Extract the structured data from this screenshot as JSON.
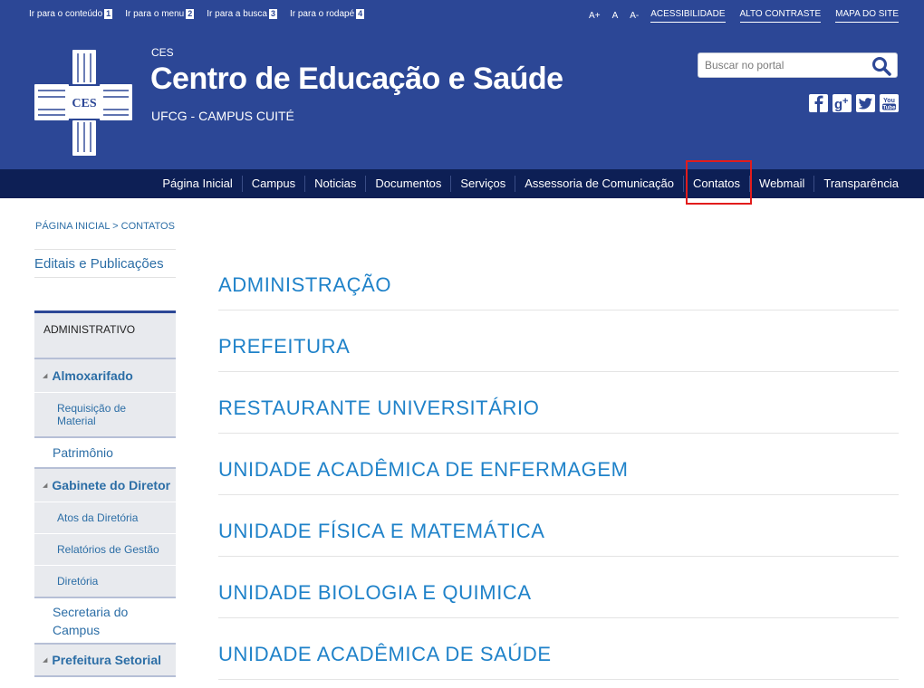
{
  "accessibility_bar": {
    "skip_links": [
      {
        "label": "Ir para o conteúdo",
        "key": "1"
      },
      {
        "label": "Ir para o menu",
        "key": "2"
      },
      {
        "label": "Ir para a busca",
        "key": "3"
      },
      {
        "label": "Ir para o rodapé",
        "key": "4"
      }
    ],
    "font_size_controls": [
      "A+",
      "A",
      "A-"
    ],
    "links": [
      "ACESSIBILIDADE",
      "ALTO CONTRASTE",
      "MAPA DO SITE"
    ]
  },
  "header": {
    "logo_text": "CES",
    "org_acronym": "CES",
    "title": "Centro de Educação e Saúde",
    "subtitle": "UFCG - CAMPUS CUITÉ",
    "search_placeholder": "Buscar no portal",
    "social_icons": [
      "facebook-icon",
      "google-plus-icon",
      "twitter-icon",
      "youtube-icon"
    ]
  },
  "nav": {
    "items": [
      "Página Inicial",
      "Campus",
      "Noticias",
      "Documentos",
      "Serviços",
      "Assessoria de Comunicação",
      "Contatos",
      "Webmail",
      "Transparência"
    ],
    "highlighted": "Contatos"
  },
  "breadcrumb": "PÁGINA INICIAL > CONTATOS",
  "sidebar": {
    "top_link": "Editais e Publicações",
    "header": "ADMINISTRATIVO",
    "groups": [
      {
        "label": "Almoxarifado",
        "items": [
          "Requisição de Material"
        ]
      },
      {
        "label": "Patrimônio",
        "items": []
      },
      {
        "label": "Gabinete do Diretor",
        "items": [
          "Atos da Diretória",
          "Relatórios de Gestão",
          "Diretória"
        ]
      },
      {
        "label": "Secretaria do Campus",
        "items": []
      },
      {
        "label": "Prefeitura Setorial",
        "items": []
      }
    ]
  },
  "main": {
    "sections": [
      "ADMINISTRAÇÃO",
      "PREFEITURA",
      "RESTAURANTE UNIVERSITÁRIO",
      "UNIDADE ACADÊMICA DE ENFERMAGEM",
      "UNIDADE FÍSICA E MATEMÁTICA",
      "UNIDADE BIOLOGIA E QUIMICA",
      "UNIDADE ACADÊMICA DE SAÚDE"
    ]
  },
  "colors": {
    "header_bg": "#2c4796",
    "nav_bg": "#0d1f55",
    "link": "#1f82c9",
    "highlight_border": "#e21c1c"
  }
}
